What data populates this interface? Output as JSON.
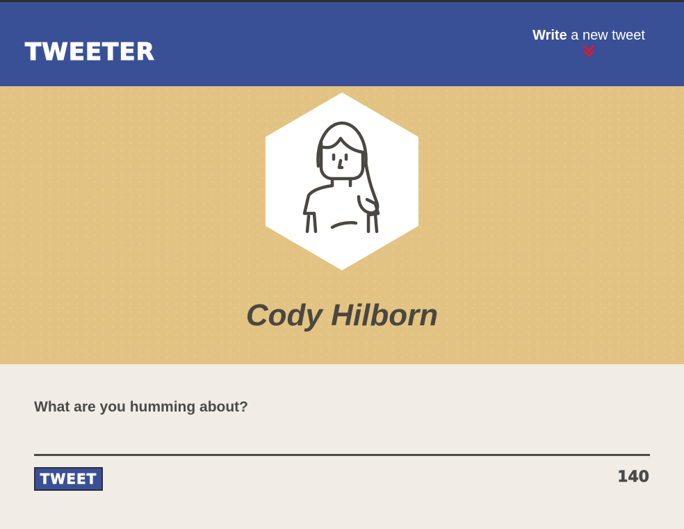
{
  "header": {
    "brand": "TWEETER",
    "compose_toggle": {
      "bold": "Write",
      "rest": " a new tweet",
      "icon": "double-chevron-down-icon",
      "icon_color": "#e0182d"
    }
  },
  "profile": {
    "name": "Cody Hilborn",
    "avatar_icon": "person-avatar-icon"
  },
  "composer": {
    "prompt": "What are you humming about?",
    "input_value": "",
    "button_label": "TWEET",
    "char_counter": "140"
  },
  "colors": {
    "nav": "#3a5096",
    "profile_bg": "#e2c382",
    "page_bg": "#f1ede6",
    "text_dark": "#4b4a48",
    "accent_red": "#e0182d"
  }
}
